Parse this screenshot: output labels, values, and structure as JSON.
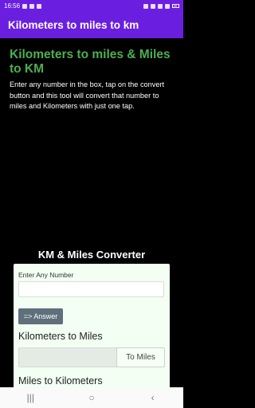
{
  "status_bar": {
    "time": "16:56",
    "icons_left": [
      "mail-icon",
      "mail-icon",
      "image-icon"
    ],
    "icons_right": [
      "bluetooth-icon",
      "mute-icon",
      "wifi-icon",
      "signal-icon",
      "battery-icon"
    ]
  },
  "app_bar": {
    "title": "Kilometers to miles to km"
  },
  "content": {
    "heading": "Kilometers to miles & Miles to KM",
    "intro": "Enter any number in the box, tap on the convert button and this tool will convert that number to miles and Kilometers with just one tap.",
    "converter_title": "KM & Miles Converter",
    "input_label": "Enter Any Number",
    "input_value": "",
    "answer_button": "=> Answer",
    "km_to_miles_label": "Kilometers to Miles",
    "km_output_value": "",
    "to_miles_button": "To Miles",
    "miles_to_km_label": "Miles to Kilometers"
  },
  "nav_bar": {
    "recents_glyph": "|||",
    "home_glyph": "○",
    "back_glyph": "‹"
  },
  "colors": {
    "app_bar": "#6a1fe0",
    "heading": "#4caf50",
    "background": "#000000",
    "card": "#f2fff2",
    "answer_button": "#5f6f7c"
  }
}
